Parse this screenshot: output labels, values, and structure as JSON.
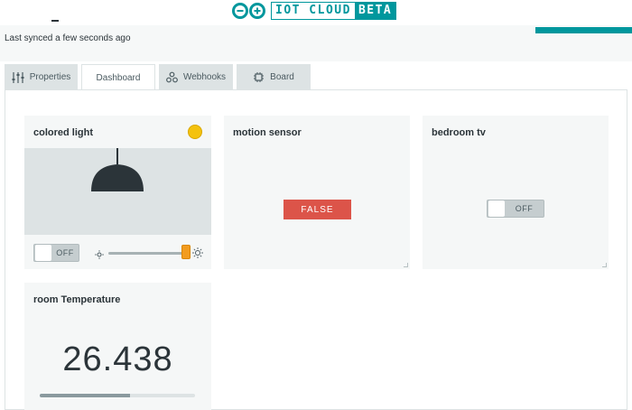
{
  "header": {
    "logo_main": "IOT CLOUD",
    "logo_badge": "BETA",
    "sync_status": "Last synced a few seconds ago",
    "accent_color": "#00979d"
  },
  "tabs": [
    {
      "label": "Properties",
      "icon": "sliders-icon",
      "active": false
    },
    {
      "label": "Dashboard",
      "icon": "",
      "active": true
    },
    {
      "label": "Webhooks",
      "icon": "webhook-icon",
      "active": false
    },
    {
      "label": "Board",
      "icon": "chip-icon",
      "active": false
    }
  ],
  "widgets": {
    "colored_light": {
      "title": "colored light",
      "color": "#f4c20d",
      "switch_label": "OFF",
      "brightness": 0.95,
      "icons": [
        "lamp-icon",
        "sun-small-icon",
        "sun-large-icon"
      ]
    },
    "motion_sensor": {
      "title": "motion sensor",
      "value": "FALSE",
      "status_color": "#dc5449"
    },
    "bedroom_tv": {
      "title": "bedroom tv",
      "switch_label": "OFF"
    },
    "room_temperature": {
      "title": "room Temperature",
      "value": "26.438",
      "level": 0.58
    }
  }
}
